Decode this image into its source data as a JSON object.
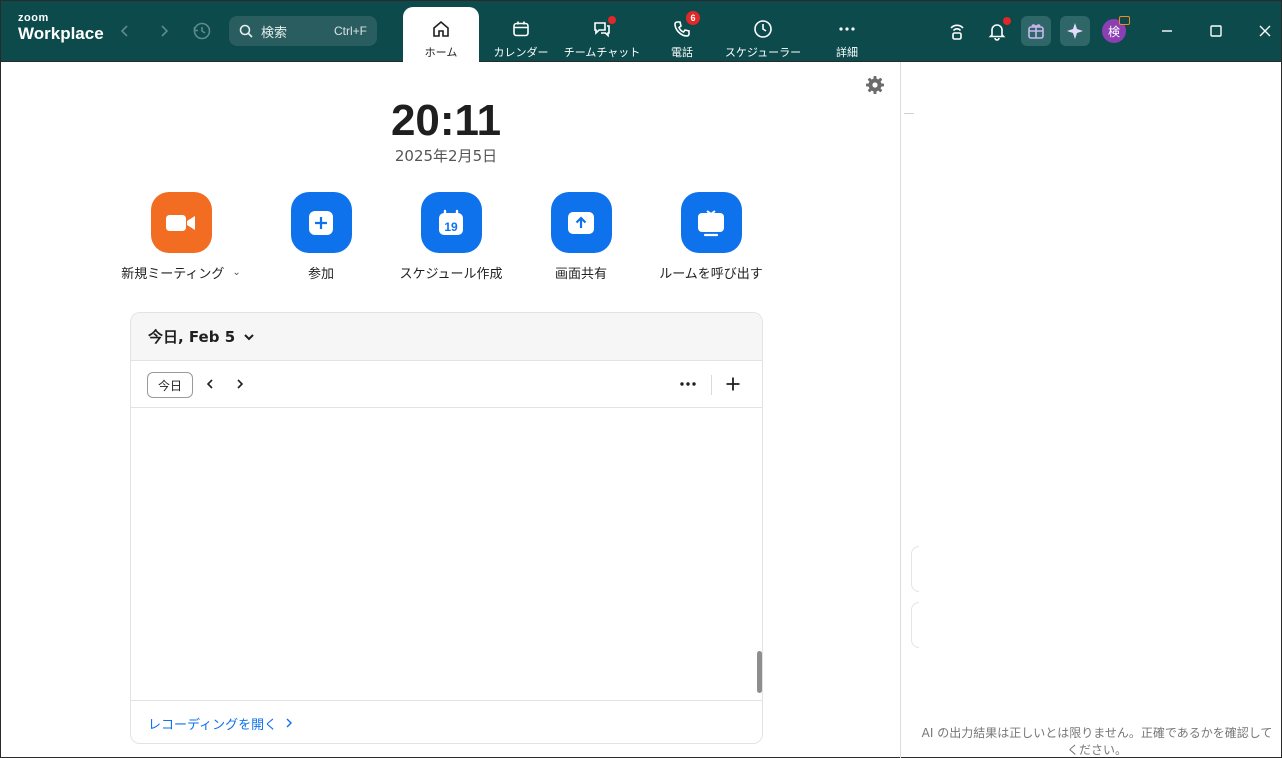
{
  "app": {
    "logo_top": "zoom",
    "logo_bottom": "Workplace"
  },
  "search": {
    "placeholder": "検索",
    "shortcut": "Ctrl+F"
  },
  "tabs": [
    {
      "label": "ホーム",
      "icon": "home-icon",
      "active": true
    },
    {
      "label": "カレンダー",
      "icon": "calendar-icon"
    },
    {
      "label": "チームチャット",
      "icon": "chat-icon",
      "dot": true
    },
    {
      "label": "電話",
      "icon": "phone-icon",
      "badge": "6"
    },
    {
      "label": "スケジューラー",
      "icon": "clock-icon"
    },
    {
      "label": "詳細",
      "icon": "more-icon"
    }
  ],
  "user": {
    "avatar_initial": "検"
  },
  "home": {
    "time": "20:11",
    "date": "2025年2月5日",
    "actions": [
      {
        "label": "新規ミーティング",
        "icon": "video-camera-icon",
        "color": "#f26d21"
      },
      {
        "label": "参加",
        "icon": "plus-icon",
        "color": "#0e72ed"
      },
      {
        "label": "スケジュール作成",
        "icon": "calendar-19-icon",
        "calendar_day": "19",
        "color": "#0e72ed"
      },
      {
        "label": "画面共有",
        "icon": "share-screen-icon",
        "color": "#0e72ed"
      },
      {
        "label": "ルームを呼び出す",
        "icon": "room-icon",
        "color": "#0e72ed"
      }
    ]
  },
  "calendar_card": {
    "title": "今日, Feb 5",
    "today_button": "今日",
    "recordings_link": "レコーディングを開く"
  },
  "right_pane": {
    "ai_disclaimer": "AI の出力結果は正しいとは限りません。正確であるかを確認してください。"
  },
  "colors": {
    "topbar": "#0c4a4c",
    "accent_blue": "#0e72ed",
    "accent_orange": "#f26d21",
    "notification_red": "#e02828"
  }
}
